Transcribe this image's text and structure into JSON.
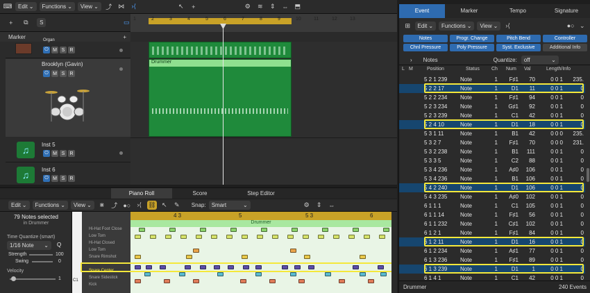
{
  "main_toolbar": {
    "edit": "Edit",
    "functions": "Functions",
    "view": "View"
  },
  "track_header": {
    "marker_label": "Marker",
    "s_label": "S"
  },
  "ruler": {
    "bars": [
      "1",
      "2",
      "3",
      "4",
      "5",
      "6",
      "7",
      "8",
      "9",
      "10",
      "11",
      "12",
      "13"
    ]
  },
  "tracks": [
    {
      "name": "Organ",
      "m": "M",
      "s": "S",
      "r": "R"
    },
    {
      "name": "Brooklyn (Gavin)",
      "m": "M",
      "s": "S",
      "r": "R"
    },
    {
      "name": "Inst 5",
      "m": "M",
      "s": "S",
      "r": "R"
    },
    {
      "name": "Inst 6",
      "m": "M",
      "s": "S",
      "r": "R"
    }
  ],
  "region": {
    "name": "Drummer"
  },
  "bottom_tabs": [
    "Piano Roll",
    "Score",
    "Step Editor"
  ],
  "piano_toolbar": {
    "edit": "Edit",
    "functions": "Functions",
    "view": "View",
    "snap_label": "Snap:",
    "snap_value": "Smart"
  },
  "inspector": {
    "selected_count": "79 Notes selected",
    "selected_in": "in Drummer",
    "time_quantize_label": "Time Quantize (smart)",
    "quantize_value": "1/16 Note",
    "q_button": "Q",
    "strength_label": "Strength",
    "strength_value": "100",
    "swing_label": "Swing",
    "swing_value": "0",
    "velocity_label": "Velocity",
    "velocity_value": "1"
  },
  "piano_ruler": {
    "labels": [
      "4 3",
      "5",
      "5 3",
      "6"
    ]
  },
  "piano_region": {
    "name": "Drummer"
  },
  "keys": [
    "Hi-Hat Foot Close",
    "Low Tom",
    "Hi-Hat Closed",
    "Low Tom",
    "Snare Rimshot",
    "",
    "Snare Center",
    "Snare Sidestick",
    "Kick"
  ],
  "c_key": "C1",
  "event_tabs": [
    "Event",
    "Marker",
    "Tempo",
    "Signature"
  ],
  "event_toolbar": {
    "edit": "Edit",
    "functions": "Functions",
    "view": "View"
  },
  "filters": [
    "Notes",
    "Progr. Change",
    "Pitch Bend",
    "Controller",
    "Chnl Pressure",
    "Poly Pressure",
    "Syst. Exclusive",
    "Additional Info"
  ],
  "event_filter": {
    "label": "Notes",
    "quantize_label": "Quantize:",
    "quantize_value": "off"
  },
  "event_columns": [
    "L",
    "M",
    "Position",
    "Status",
    "Ch",
    "Num",
    "Val",
    "Length/Info"
  ],
  "events": [
    {
      "pos": "5 2 1 239",
      "status": "Note",
      "ch": "1",
      "num": "F♯1",
      "val": "70",
      "len": "0 0 1",
      "info": "235.",
      "sel": false
    },
    {
      "pos": "5 2 2  17",
      "status": "Note",
      "ch": "1",
      "num": "D1",
      "val": "11",
      "len": "0 0 1",
      "info": "0",
      "sel": true
    },
    {
      "pos": "5 2 2 234",
      "status": "Note",
      "ch": "1",
      "num": "F♯1",
      "val": "94",
      "len": "0 0 1",
      "info": "0",
      "sel": false
    },
    {
      "pos": "5 2 3 234",
      "status": "Note",
      "ch": "1",
      "num": "G♯1",
      "val": "92",
      "len": "0 0 1",
      "info": "0",
      "sel": false
    },
    {
      "pos": "5 2 3 239",
      "status": "Note",
      "ch": "1",
      "num": "C1",
      "val": "42",
      "len": "0 0 1",
      "info": "0",
      "sel": false
    },
    {
      "pos": "5 2 4  10",
      "status": "Note",
      "ch": "1",
      "num": "D1",
      "val": "18",
      "len": "0 0 1",
      "info": "0",
      "sel": true
    },
    {
      "pos": "5 3 1  11",
      "status": "Note",
      "ch": "1",
      "num": "B1",
      "val": "42",
      "len": "0 0 0",
      "info": "235.",
      "sel": false
    },
    {
      "pos": "5 3 2    7",
      "status": "Note",
      "ch": "1",
      "num": "F♯1",
      "val": "70",
      "len": "0 0 0",
      "info": "231.",
      "sel": false
    },
    {
      "pos": "5 3 2 238",
      "status": "Note",
      "ch": "1",
      "num": "B1",
      "val": "111",
      "sel": false,
      "len": "0 0 1",
      "info": "0"
    },
    {
      "pos": "5 3 3    5",
      "status": "Note",
      "ch": "1",
      "num": "C2",
      "val": "88",
      "len": "0 0 1",
      "info": "0",
      "sel": false
    },
    {
      "pos": "5 3 4 236",
      "status": "Note",
      "ch": "1",
      "num": "A♯0",
      "val": "106",
      "len": "0 0 1",
      "info": "0",
      "sel": false
    },
    {
      "pos": "5 3 4 236",
      "status": "Note",
      "ch": "1",
      "num": "B1",
      "val": "106",
      "len": "0 0 1",
      "info": "0",
      "sel": false
    },
    {
      "pos": "5 4 2 240",
      "status": "Note",
      "ch": "1",
      "num": "D1",
      "val": "106",
      "len": "0 0 1",
      "info": "0",
      "sel": true
    },
    {
      "pos": "5 4 3 235",
      "status": "Note",
      "ch": "1",
      "num": "A♯0",
      "val": "102",
      "len": "0 0 1",
      "info": "0",
      "sel": false
    },
    {
      "pos": "6 1 1    1",
      "status": "Note",
      "ch": "1",
      "num": "C1",
      "val": "105",
      "len": "0 0 1",
      "info": "0",
      "sel": false
    },
    {
      "pos": "6 1 1  14",
      "status": "Note",
      "ch": "1",
      "num": "F♯1",
      "val": "56",
      "len": "0 0 1",
      "info": "0",
      "sel": false
    },
    {
      "pos": "6 1 1 232",
      "status": "Note",
      "ch": "1",
      "num": "C♯1",
      "val": "102",
      "len": "0 0 1",
      "info": "0",
      "sel": false
    },
    {
      "pos": "6 1 2    1",
      "status": "Note",
      "ch": "1",
      "num": "F♯1",
      "val": "84",
      "len": "0 0 1",
      "info": "0",
      "sel": false
    },
    {
      "pos": "6 1 2  11",
      "status": "Note",
      "ch": "1",
      "num": "D1",
      "val": "16",
      "len": "0 0 1",
      "info": "0",
      "sel": true
    },
    {
      "pos": "6 1 2 234",
      "status": "Note",
      "ch": "1",
      "num": "A♯1",
      "val": "77",
      "len": "0 0 1",
      "info": "0",
      "sel": false
    },
    {
      "pos": "6 1 3 236",
      "status": "Note",
      "ch": "1",
      "num": "F♯1",
      "val": "89",
      "len": "0 0 1",
      "info": "0",
      "sel": false
    },
    {
      "pos": "6 1 3 239",
      "status": "Note",
      "ch": "1",
      "num": "D1",
      "val": "1",
      "len": "0 0 1",
      "info": "0",
      "sel": true
    },
    {
      "pos": "6 1 4    1",
      "status": "Note",
      "ch": "1",
      "num": "C1",
      "val": "42",
      "len": "0 0 1",
      "info": "0",
      "sel": false
    }
  ],
  "event_footer": {
    "region": "Drummer",
    "count": "240 Events"
  },
  "colors": {
    "accent_yellow": "#f4e83b",
    "region_green": "#1f8a3b",
    "selection_blue": "#16466f",
    "ruler_gold": "#c9a227"
  }
}
